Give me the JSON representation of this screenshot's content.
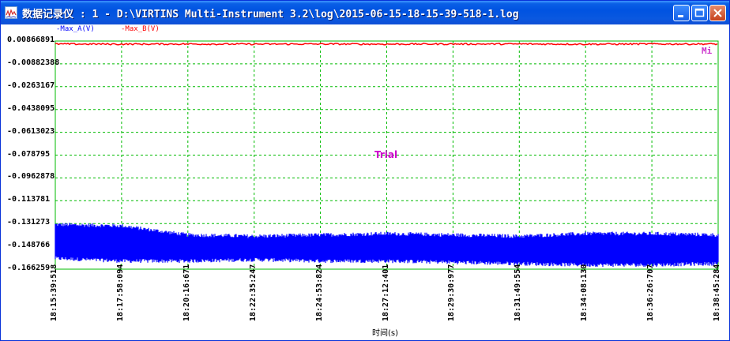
{
  "window": {
    "title": "数据记录仪 : 1 - D:\\VIRTINS Multi-Instrument 3.2\\log\\2015-06-15-18-15-39-518-1.log",
    "minimize_icon": "minimize-icon",
    "maximize_icon": "maximize-icon",
    "close_icon": "close-icon"
  },
  "legend": [
    {
      "name": "Max_A(V)",
      "color": "#0000ff"
    },
    {
      "name": "Max_B(V)",
      "color": "#ff0000"
    }
  ],
  "overlay": {
    "watermark": "Trial",
    "corner_label": "Mi"
  },
  "chart_data": {
    "type": "line",
    "xlabel": "时间(s)",
    "ylabel": "",
    "ylim": [
      -0.166259,
      0.00866891
    ],
    "yticks": [
      "0.00866891",
      "-0.00882388",
      "-0.0263167",
      "-0.0438095",
      "-0.0613023",
      "-0.078795",
      "-0.0962878",
      "-0.113781",
      "-0.131273",
      "-0.148766",
      "-0.166259"
    ],
    "xticks": [
      "18:15:39:518",
      "18:17:58:094",
      "18:20:16:671",
      "18:22:35:247",
      "18:24:53:824",
      "18:27:12:401",
      "18:29:30:977",
      "18:31:49:554",
      "18:34:08:130",
      "18:36:26:707",
      "18:38:45:284"
    ],
    "grid": true,
    "grid_color": "#00bb00",
    "background": "#ffffff",
    "series": [
      {
        "name": "Max_A(V)",
        "color": "#0000ff",
        "band_upper": [
          -0.132,
          -0.133,
          -0.14,
          -0.141,
          -0.14,
          -0.139,
          -0.14,
          -0.141,
          -0.139,
          -0.139,
          -0.14
        ],
        "band_lower": [
          -0.158,
          -0.16,
          -0.16,
          -0.159,
          -0.16,
          -0.16,
          -0.161,
          -0.162,
          -0.163,
          -0.163,
          -0.162
        ]
      },
      {
        "name": "Max_B(V)",
        "color": "#ff0000",
        "values": [
          0.0064,
          0.0063,
          0.0064,
          0.0063,
          0.0064,
          0.0063,
          0.0064,
          0.0064,
          0.0063,
          0.0064,
          0.0064
        ]
      }
    ]
  }
}
